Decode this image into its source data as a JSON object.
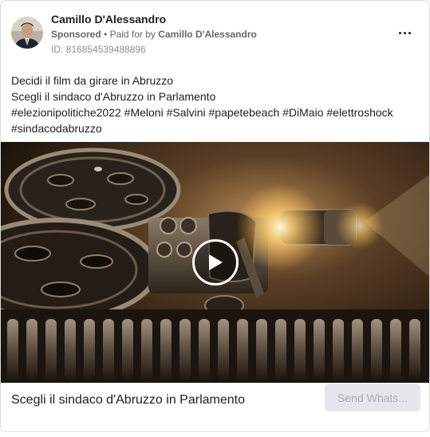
{
  "advertiser": {
    "name": "Camillo D'Alessandro",
    "sponsored_label": "Sponsored",
    "paid_for_prefix": "Paid for by",
    "paid_for_name": "Camillo D'Alessandro",
    "separator": "•",
    "ad_id": "ID: 816854539488896"
  },
  "menu": {
    "icon": "more-horizontal-icon"
  },
  "post": {
    "lines": [
      "Decidi il film da girare in Abruzzo",
      "Scegli il sindaco d'Abruzzo in Parlamento",
      "#elezionipolitiche2022 #Meloni #Salvini #papetebeach #DiMaio #elettroshock",
      "#sindacodabruzzo"
    ]
  },
  "media": {
    "type": "video",
    "subject": "vintage film projector reels",
    "play_icon": "play-icon"
  },
  "footer": {
    "headline": "Scegli il sindaco d'Abruzzo in Parlamento",
    "cta_label": "Send Whats..."
  },
  "colors": {
    "text_primary": "#1c1e21",
    "text_secondary": "#65676b",
    "button_bg": "#e4e6eb",
    "button_text": "#a8abaf",
    "border": "#dadde1"
  }
}
